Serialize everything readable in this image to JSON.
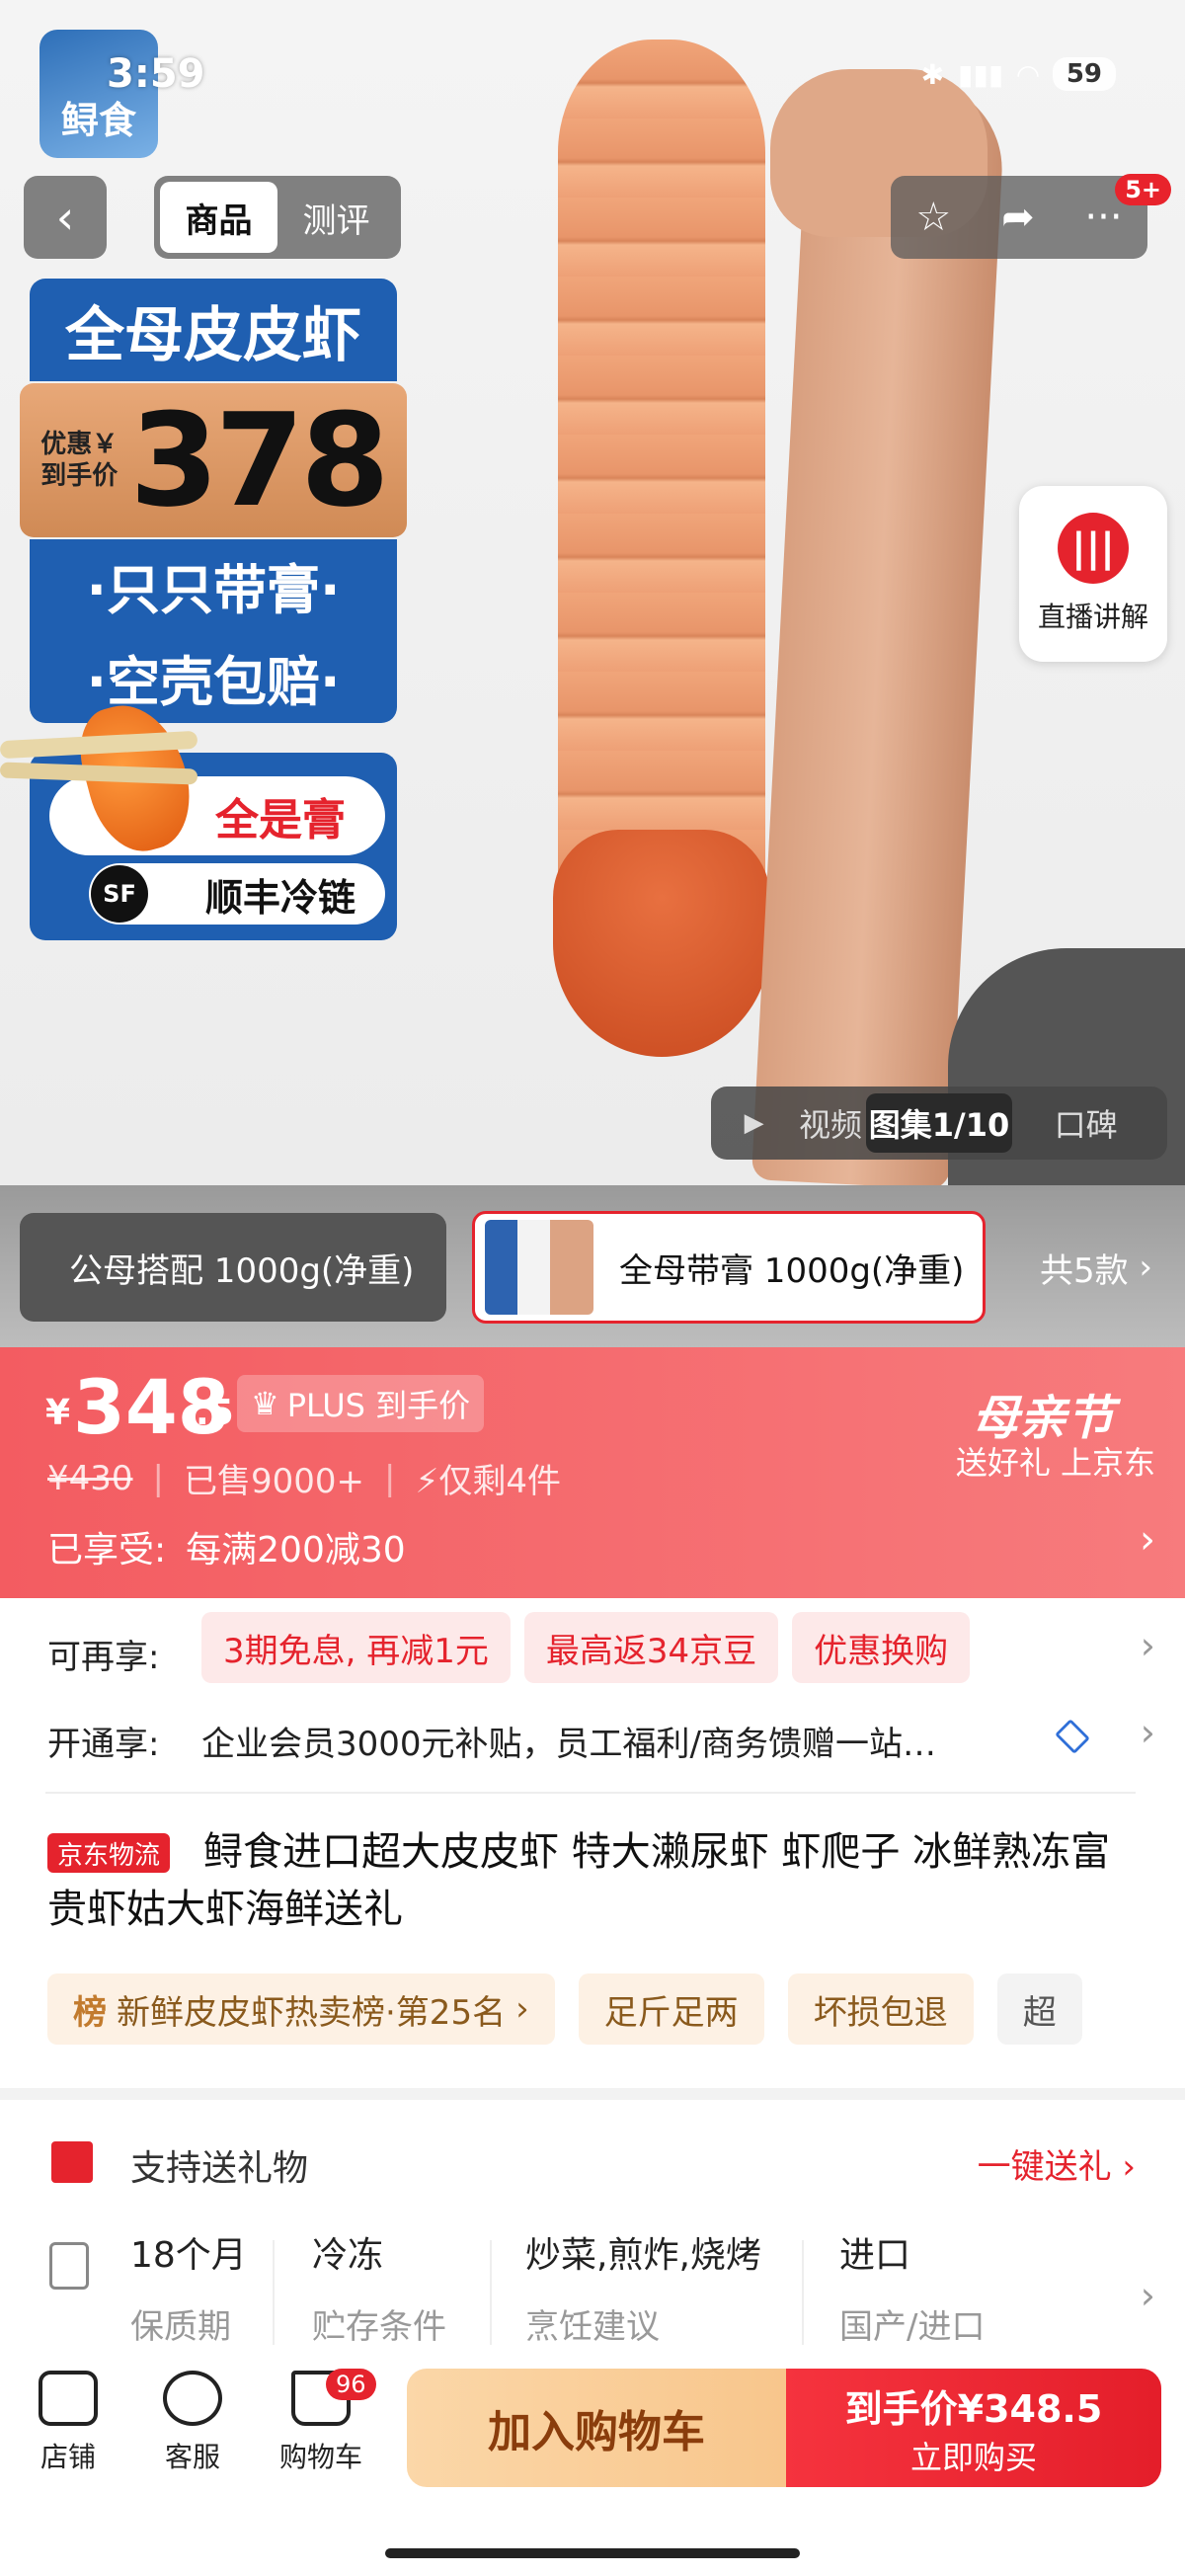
{
  "status_bar": {
    "time": "3:59",
    "battery": "59"
  },
  "brand_logo_text": "鲟食",
  "header": {
    "tabs": [
      "商品",
      "测评"
    ],
    "active_tab": "商品",
    "notification_badge": "5+",
    "icons": [
      "back-icon",
      "star-icon",
      "share-icon",
      "more-icon"
    ]
  },
  "promo_image": {
    "title": "全母皮皮虾",
    "price_label_line1": "优惠￥",
    "price_label_line2": "到手价",
    "price": "378",
    "feature1": "·只只带膏·",
    "feature2": "·空壳包赔·",
    "roe_label": "全是膏",
    "shipping_label": "顺丰冷链",
    "sf_logo": "SF"
  },
  "live_button": {
    "label": "直播讲解"
  },
  "media_tabs": [
    "视频",
    "图集1/10",
    "口碑"
  ],
  "media_active": "图集1/10",
  "variants": {
    "items": [
      {
        "label": "公母搭配 1000g(净重)",
        "selected": false
      },
      {
        "label": "全母带膏 1000g(净重)",
        "selected": true
      }
    ],
    "total": "共5款"
  },
  "price_banner": {
    "currency": "¥",
    "price_main": "348",
    "price_fraction": ".5",
    "plus_label": "PLUS 到手价",
    "original_price": "¥430",
    "sold": "已售9000+",
    "stock": "仅剩4件",
    "enjoyed_label": "已享受:",
    "enjoyed_value": "每满200减30",
    "event_title": "母亲节",
    "event_sub": "送好礼 上京东",
    "accent_color": "#f35c61"
  },
  "offers": {
    "label": "可再享:",
    "chips": [
      "3期免息, 再减1元",
      "最高返34京豆",
      "优惠换购"
    ]
  },
  "membership": {
    "label": "开通享:",
    "text": "企业会员3000元补贴，员工福利/商务馈赠一站…"
  },
  "product": {
    "logistics_badge": "京东物流",
    "title": "鲟食进口超大皮皮虾 特大濑尿虾 虾爬子 冰鲜熟冻富贵虾姑大虾海鲜送礼"
  },
  "tags": {
    "rank_prefix": "榜",
    "rank_text": "新鲜皮皮虾热卖榜·第25名",
    "items": [
      "足斤足两",
      "坏损包退",
      "超"
    ]
  },
  "gift": {
    "label": "支持送礼物",
    "link": "一键送礼"
  },
  "specs": [
    {
      "value": "18个月",
      "key": "保质期"
    },
    {
      "value": "冷冻",
      "key": "贮存条件"
    },
    {
      "value": "炒菜,煎炸,烧烤",
      "key": "烹饪建议"
    },
    {
      "value": "进口",
      "key": "国产/进口"
    }
  ],
  "bottom_bar": {
    "store": "店铺",
    "service": "客服",
    "cart": "购物车",
    "cart_count": "96",
    "add_to_cart": "加入购物车",
    "buy_line1": "到手价¥348.5",
    "buy_line2": "立即购买"
  }
}
